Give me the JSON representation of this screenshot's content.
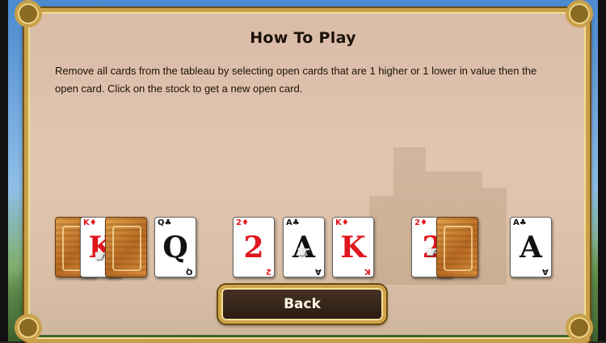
{
  "dialog": {
    "title": "How To Play",
    "instructions": "Remove all cards from the tableau by selecting open cards that are 1 higher or 1 lower in value then the open card. Click on the stock to get a new open card."
  },
  "cards": [
    {
      "rank": "",
      "suit": "",
      "face_down": true
    },
    {
      "rank": "K",
      "suit": "♦",
      "color": "red"
    },
    {
      "rank": "",
      "suit": "",
      "face_down": true
    },
    {
      "rank": "Q",
      "suit": "♣",
      "color": "black"
    },
    {
      "rank": "2",
      "suit": "♦",
      "color": "red"
    },
    {
      "rank": "A",
      "suit": "♣",
      "color": "black"
    },
    {
      "rank": "K",
      "suit": "♦",
      "color": "red"
    },
    {
      "rank": "2",
      "suit": "♦",
      "color": "red"
    },
    {
      "rank": "",
      "suit": "",
      "face_down": true
    },
    {
      "rank": "A",
      "suit": "♣",
      "color": "black"
    }
  ],
  "buttons": {
    "back_label": "Back"
  },
  "icons": {
    "pointer": "hand-pointer-icon"
  },
  "colors": {
    "frame_gold": "#c9a04a",
    "panel": "#e2c6b0",
    "button_bg": "#2a1b12",
    "card_red": "#e0161d"
  }
}
